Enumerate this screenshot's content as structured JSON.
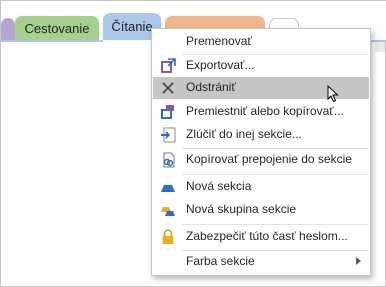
{
  "tabs": [
    {
      "label": ""
    },
    {
      "label": "Cestovanie"
    },
    {
      "label": "Čítanie"
    },
    {
      "label": ""
    }
  ],
  "context_menu": {
    "items": [
      {
        "label": "Premenovať",
        "icon": "none"
      },
      {
        "label": "Exportovať...",
        "icon": "export-icon"
      },
      {
        "label": "Odstrániť",
        "icon": "delete-icon"
      },
      {
        "label": "Premiestniť alebo kopírovať...",
        "icon": "move-copy-icon"
      },
      {
        "label": "Zlúčiť do inej sekcie...",
        "icon": "merge-icon"
      },
      {
        "label": "Kopírovať prepojenie do sekcie",
        "icon": "copy-link-icon"
      },
      {
        "label": "Nová sekcia",
        "icon": "new-section-icon"
      },
      {
        "label": "Nová skupina sekcie",
        "icon": "new-section-group-icon"
      },
      {
        "label": "Zabezpečiť túto časť heslom...",
        "icon": "lock-icon"
      },
      {
        "label": "Farba sekcie",
        "icon": "none"
      }
    ],
    "highlighted": "Odstrániť"
  },
  "colors": {
    "tab_purple": "#b7a6cf",
    "tab_green": "#a7d08c",
    "tab_blue": "#a9c8ea",
    "tab_orange": "#f2b88c",
    "menu_hover": "#c6c6c6"
  }
}
